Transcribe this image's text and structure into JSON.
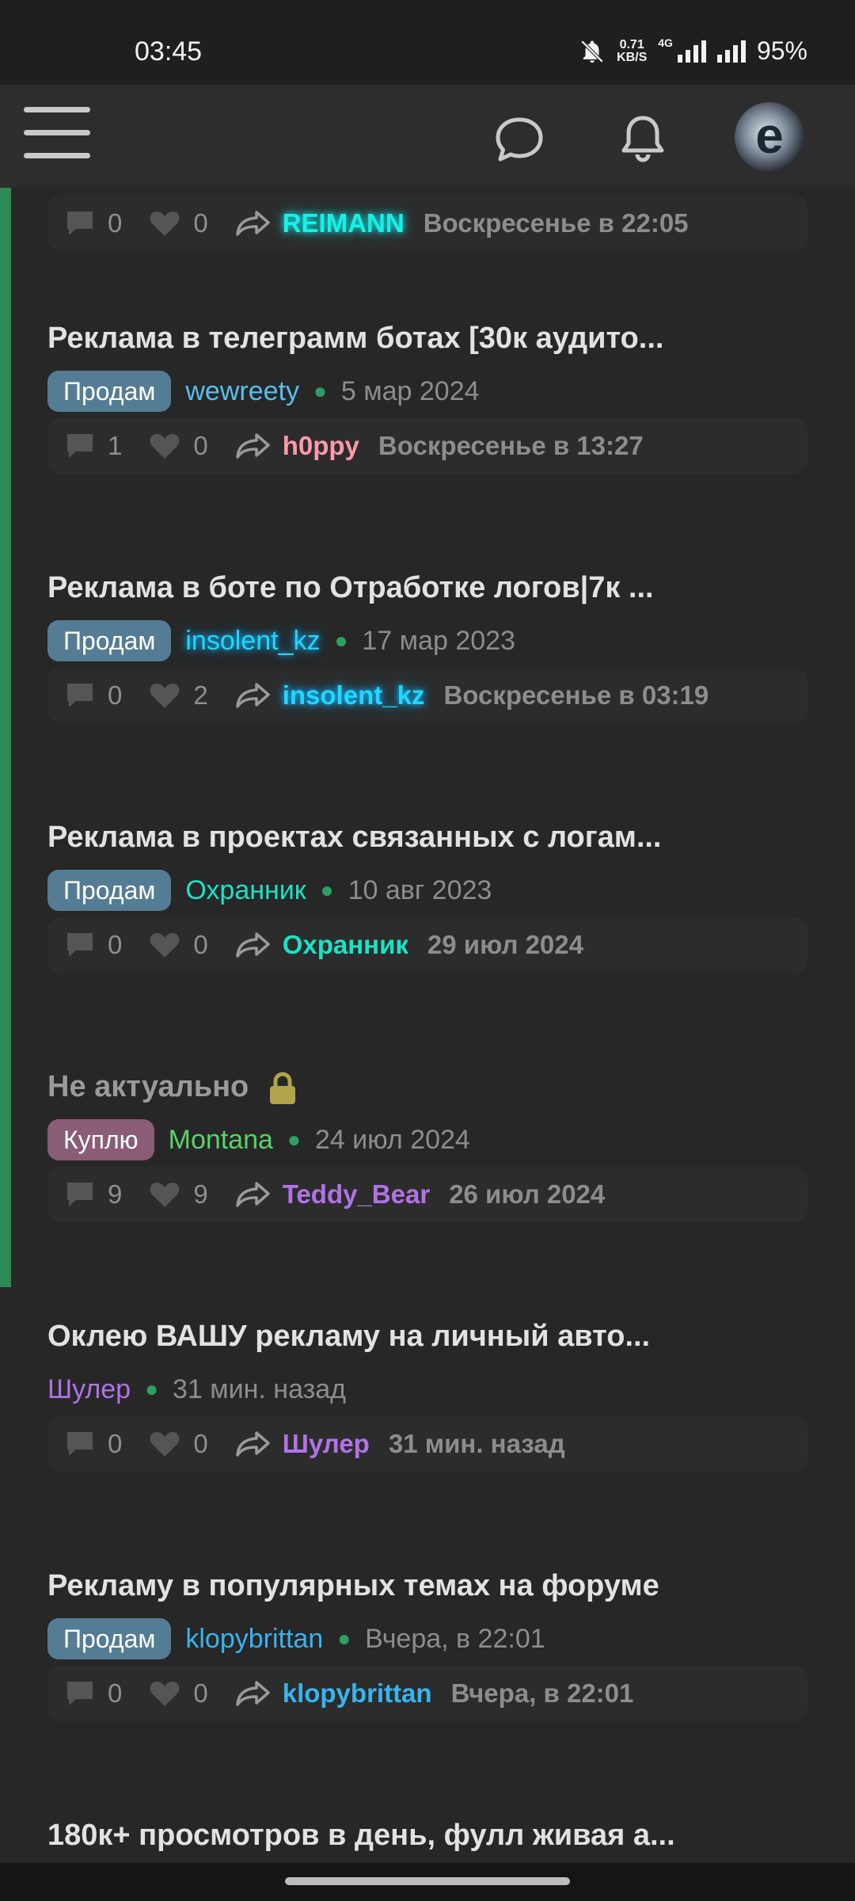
{
  "status": {
    "time": "03:45",
    "speed_value": "0.71",
    "speed_unit": "KB/S",
    "network": "4G",
    "battery": "95%"
  },
  "header": {
    "menu_icon": "hamburger-icon",
    "chat_icon": "chat-bubble-icon",
    "bell_icon": "bell-icon",
    "avatar_letter": "e"
  },
  "threads": [
    {
      "title": "",
      "stats": {
        "comments": "0",
        "likes": "0",
        "last_user": "REIMANN",
        "last_date": "Воскресенье в 22:05"
      }
    },
    {
      "title": "Реклама в телеграмм ботах [30к аудито...",
      "tag": "Продам",
      "author": "wewreety",
      "date": "5 мар 2024",
      "stats": {
        "comments": "1",
        "likes": "0",
        "last_user": "h0ppy",
        "last_date": "Воскресенье в 13:27"
      }
    },
    {
      "title": "Реклама в боте по Отработке логов|7к ...",
      "tag": "Продам",
      "author": "insolent_kz",
      "date": "17 мар 2023",
      "stats": {
        "comments": "0",
        "likes": "2",
        "last_user": "insolent_kz",
        "last_date": "Воскресенье в 03:19"
      }
    },
    {
      "title": "Реклама в проектах связанных с логам...",
      "tag": "Продам",
      "author": "Охранник",
      "date": "10 авг 2023",
      "stats": {
        "comments": "0",
        "likes": "0",
        "last_user": "Охранник",
        "last_date": "29 июл 2024"
      }
    },
    {
      "title": "Не актуально",
      "tag": "Куплю",
      "author": "Montana",
      "date": "24 июл 2024",
      "stats": {
        "comments": "9",
        "likes": "9",
        "last_user": "Teddy_Bear",
        "last_date": "26 июл 2024"
      }
    },
    {
      "title": "Оклею ВАШУ рекламу на личный авто...",
      "author": "Шулер",
      "date": "31 мин. назад",
      "stats": {
        "comments": "0",
        "likes": "0",
        "last_user": "Шулер",
        "last_date": "31 мин. назад"
      }
    },
    {
      "title": "Рекламу в популярных темах на форуме",
      "tag": "Продам",
      "author": "klopybrittan",
      "date": "Вчера, в 22:01",
      "stats": {
        "comments": "0",
        "likes": "0",
        "last_user": "klopybrittan",
        "last_date": "Вчера, в 22:01"
      }
    },
    {
      "title": "180к+ просмотров в день, фулл живая а..."
    }
  ],
  "colors": {
    "accent_green": "#2e8a55",
    "tag_sell": "#547c95",
    "tag_buy": "#8a5c75"
  }
}
